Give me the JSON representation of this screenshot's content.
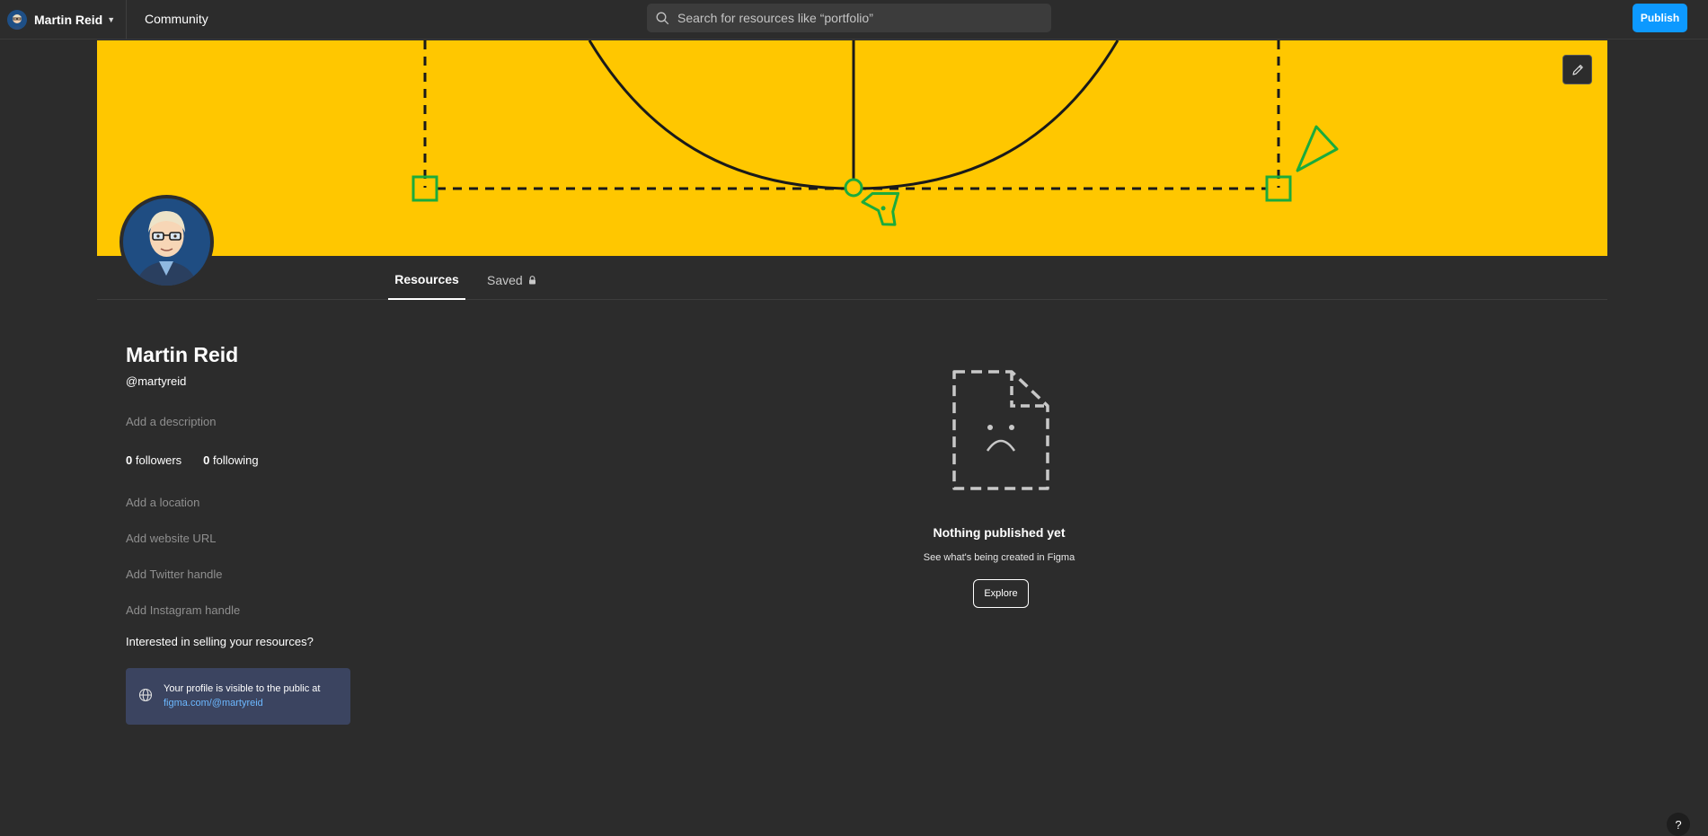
{
  "topbar": {
    "user_name": "Martin Reid",
    "community_label": "Community",
    "search_placeholder": "Search for resources like “portfolio”",
    "publish_label": "Publish"
  },
  "tabs": [
    {
      "label": "Resources",
      "active": true
    },
    {
      "label": "Saved",
      "icon": "lock-icon",
      "active": false
    }
  ],
  "profile": {
    "name": "Martin Reid",
    "handle": "@martyreid",
    "description_placeholder": "Add a description",
    "followers_count": "0",
    "followers_label": "followers",
    "following_count": "0",
    "following_label": "following",
    "location_placeholder": "Add a location",
    "website_placeholder": "Add website URL",
    "twitter_placeholder": "Add Twitter handle",
    "instagram_placeholder": "Add Instagram handle",
    "sell_prompt": "Interested in selling your resources?",
    "visibility_text": "Your profile is visible to the public at",
    "visibility_url": "figma.com/@martyreid"
  },
  "empty_state": {
    "title": "Nothing published yet",
    "subtitle": "See what's being created in Figma",
    "button_label": "Explore"
  },
  "help_label": "?",
  "colors": {
    "background": "#2c2c2c",
    "banner": "#ffc700",
    "accent_blue": "#0d99ff",
    "banner_green": "#1bab3c",
    "card_bg": "#3b4460"
  }
}
